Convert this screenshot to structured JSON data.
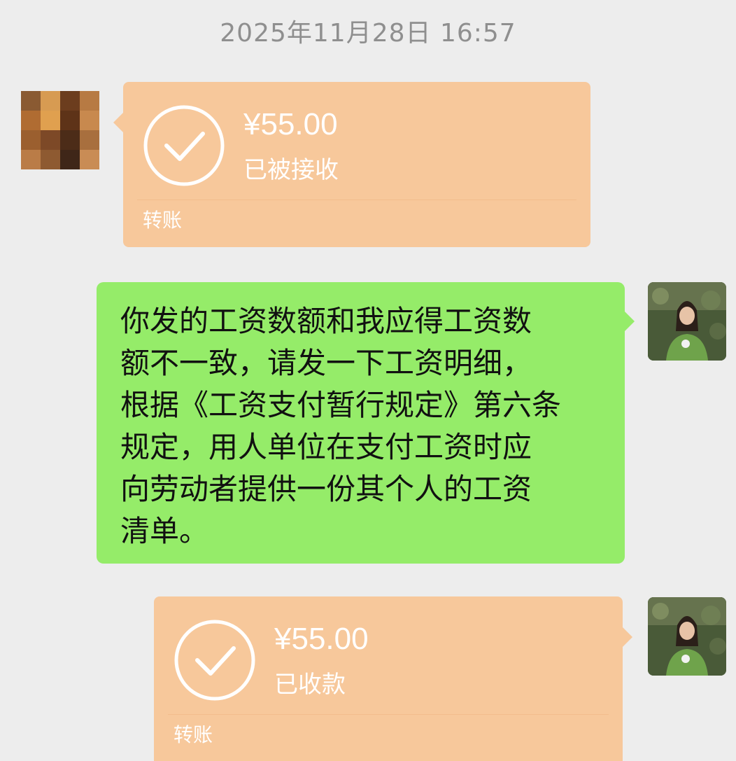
{
  "chat": {
    "timestamp": "2025年11月28日 16:57",
    "messages": [
      {
        "sender": "contact",
        "type": "transfer",
        "amount": "¥55.00",
        "status": "已被接收",
        "label": "转账",
        "color": "#f7c89b"
      },
      {
        "sender": "self",
        "type": "text",
        "lines": [
          "你发的工资数额和我应得工资数",
          "额不一致，请发一下工资明细，",
          "根据《工资支付暂行规定》第六条",
          "规定，用人单位在支付工资时应",
          "向劳动者提供一份其个人的工资",
          "清单。"
        ],
        "color": "#95ec69"
      },
      {
        "sender": "self",
        "type": "transfer",
        "amount": "¥55.00",
        "status": "已收款",
        "label": "转账",
        "color": "#f7c89b"
      }
    ]
  },
  "icons": {
    "check_icon": "check-circle-icon",
    "contact_avatar": "pixelated-avatar",
    "self_avatar": "photo-avatar"
  }
}
